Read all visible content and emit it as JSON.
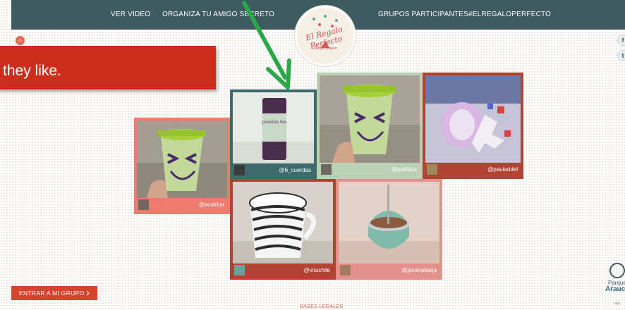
{
  "nav": {
    "left": [
      "VER VIDEO",
      "ORGANIZA TU AMIGO SECRETO"
    ],
    "right": [
      "GRUPOS PARTICIPANTES",
      "#ELREGALOPERFECTO"
    ]
  },
  "logo": {
    "title": "El Regalo Perfecto",
    "subtitle": "Parque Arauco"
  },
  "caption": {
    "text": "they like."
  },
  "tiles": [
    {
      "user": "@azaldua",
      "color": "#f17a6e",
      "image": "cup-face-icon"
    },
    {
      "user": "@6_cuerdas",
      "color": "#3d6a6c",
      "image": "tea-tin-icon"
    },
    {
      "user": "@azaldua",
      "color": "#b9d2b4",
      "image": "cup-face-icon"
    },
    {
      "user": "@pauladdel",
      "color": "#b24232",
      "image": "toy-icon"
    },
    {
      "user": "@vouchile",
      "color": "#b24232",
      "image": "mug-icon"
    },
    {
      "user": "@javierabarja",
      "color": "#e3918a",
      "image": "mate-icon"
    }
  ],
  "cta": {
    "label": "ENTRAR A MI GRUPO",
    "chevron": "›"
  },
  "footer": {
    "bases": "BASES LEGALES"
  },
  "brand": {
    "line1": "Parque",
    "line2": "Arauco",
    "line3": "raja"
  },
  "icons": {
    "home": "home-icon",
    "facebook": "facebook-icon",
    "twitter": "twitter-icon"
  }
}
